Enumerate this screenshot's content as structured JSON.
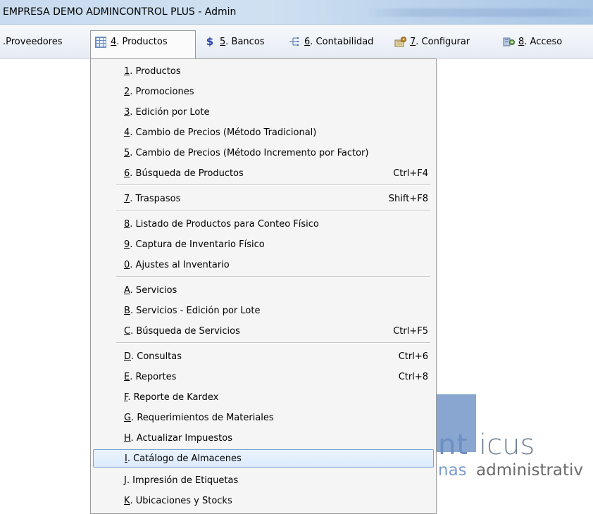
{
  "window": {
    "title": "EMPRESA DEMO ADMINCONTROL PLUS - Admin"
  },
  "menubar": {
    "items": [
      {
        "prefix": ". ",
        "label": "Proveedores"
      },
      {
        "key": "4",
        "label": ". Productos",
        "icon": "table-icon"
      },
      {
        "key": "5",
        "label": ". Bancos",
        "icon": "dollar-icon"
      },
      {
        "key": "6",
        "label": ". Contabilidad",
        "icon": "tree-icon"
      },
      {
        "key": "7",
        "label": ". Configurar",
        "icon": "settings-icon"
      },
      {
        "key": "8",
        "label": ". Acceso",
        "icon": "access-icon"
      }
    ]
  },
  "dropdown": {
    "items": [
      {
        "key": "1",
        "rest": ". Productos",
        "shortcut": ""
      },
      {
        "key": "2",
        "rest": ". Promociones",
        "shortcut": ""
      },
      {
        "key": "3",
        "rest": ". Edición por Lote",
        "shortcut": ""
      },
      {
        "key": "4",
        "rest": ". Cambio de Precios (Método Tradicional)",
        "shortcut": ""
      },
      {
        "key": "5",
        "rest": ". Cambio de Precios (Método Incremento por Factor)",
        "shortcut": ""
      },
      {
        "key": "6",
        "rest": ". Búsqueda de Productos",
        "shortcut": "Ctrl+F4"
      },
      {
        "key": "7",
        "rest": ". Traspasos",
        "shortcut": "Shift+F8"
      },
      {
        "key": "8",
        "rest": ". Listado de Productos para Conteo Físico",
        "shortcut": ""
      },
      {
        "key": "9",
        "rest": ". Captura de Inventario Físico",
        "shortcut": ""
      },
      {
        "key": "0",
        "rest": ". Ajustes al Inventario",
        "shortcut": ""
      },
      {
        "key": "A",
        "rest": ". Servicios",
        "shortcut": ""
      },
      {
        "key": "B",
        "rest": ". Servicios - Edición por Lote",
        "shortcut": ""
      },
      {
        "key": "C",
        "rest": ". Búsqueda de Servicios",
        "shortcut": "Ctrl+F5"
      },
      {
        "key": "D",
        "rest": ". Consultas",
        "shortcut": "Ctrl+6"
      },
      {
        "key": "E",
        "rest": ". Reportes",
        "shortcut": "Ctrl+8"
      },
      {
        "key": "F",
        "rest": ". Reporte de Kardex",
        "shortcut": ""
      },
      {
        "key": "G",
        "rest": ". Requerimientos de Materiales",
        "shortcut": ""
      },
      {
        "key": "H",
        "rest": ". Actualizar Impuestos",
        "shortcut": ""
      },
      {
        "key": "I",
        "rest": ". Catálogo de Almacenes",
        "shortcut": ""
      },
      {
        "key": "J",
        "rest": ". Impresión de Etiquetas",
        "shortcut": ""
      },
      {
        "key": "K",
        "rest": ". Ubicaciones y Stocks",
        "shortcut": ""
      }
    ]
  },
  "logo": {
    "part1": "nt",
    "part2": "icus",
    "sub1": "nas",
    "sub2": "administrativ"
  },
  "colors": {
    "highlight_border": "#7da2ce",
    "logo_blue": "#7b9ccb"
  }
}
